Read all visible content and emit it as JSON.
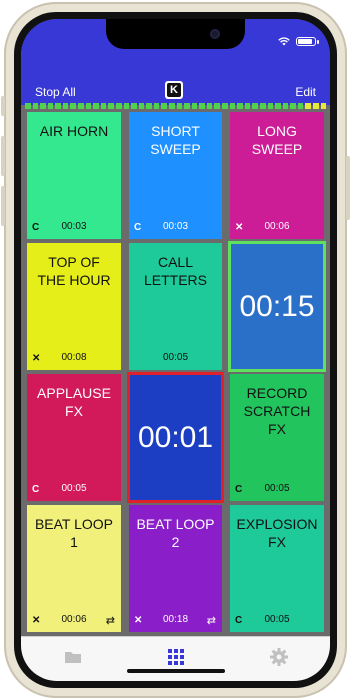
{
  "toolbar": {
    "left_label": "Stop All",
    "right_label": "Edit",
    "logo_letter": "K"
  },
  "icons": {
    "wifi": "wifi-icon",
    "battery": "battery-icon",
    "folder": "folder-icon",
    "grid": "grid-icon",
    "gear": "gear-icon"
  },
  "pads": [
    {
      "label": "AIR HORN",
      "duration": "00:03",
      "color": "#33e88e",
      "left_icon": "C",
      "right_icon": ""
    },
    {
      "label": "SHORT\nSWEEP",
      "duration": "00:03",
      "color": "#1e90ff",
      "left_icon": "C",
      "right_icon": "",
      "text_color": "#ffffff"
    },
    {
      "label": "LONG\nSWEEP",
      "duration": "00:06",
      "color": "#cc1c96",
      "left_icon": "✕",
      "right_icon": "",
      "text_color": "#ffffff"
    },
    {
      "label": "TOP OF\nTHE HOUR",
      "duration": "00:08",
      "color": "#e6ee1a",
      "left_icon": "✕",
      "right_icon": ""
    },
    {
      "label": "CALL\nLETTERS",
      "duration": "00:05",
      "color": "#1ec99a",
      "left_icon": "",
      "right_icon": ""
    },
    {
      "timer": "00:15",
      "color": "#2a70c8",
      "border": "#5ee15e"
    },
    {
      "label": "APPLAUSE\nFX",
      "duration": "00:05",
      "color": "#d21a5a",
      "left_icon": "C",
      "right_icon": "",
      "text_color": "#ffffff"
    },
    {
      "timer": "00:01",
      "color": "#1c3ec2",
      "border": "#e0202a"
    },
    {
      "label": "RECORD\nSCRATCH\nFX",
      "duration": "00:05",
      "color": "#22c45e",
      "left_icon": "C",
      "right_icon": ""
    },
    {
      "label": "BEAT LOOP\n1",
      "duration": "00:06",
      "color": "#f0f07a",
      "left_icon": "✕",
      "right_icon": "⇄"
    },
    {
      "label": "BEAT LOOP\n2",
      "duration": "00:18",
      "color": "#8a1ec8",
      "left_icon": "✕",
      "right_icon": "⇄",
      "text_color": "#ffffff"
    },
    {
      "label": "EXPLOSION\nFX",
      "duration": "00:05",
      "color": "#1ec99a",
      "left_icon": "C",
      "right_icon": ""
    }
  ],
  "tabs": [
    {
      "name": "folder-icon",
      "color": "#c0c0c0"
    },
    {
      "name": "grid-icon",
      "color": "#3838d6"
    },
    {
      "name": "gear-icon",
      "color": "#c0c0c0"
    }
  ]
}
